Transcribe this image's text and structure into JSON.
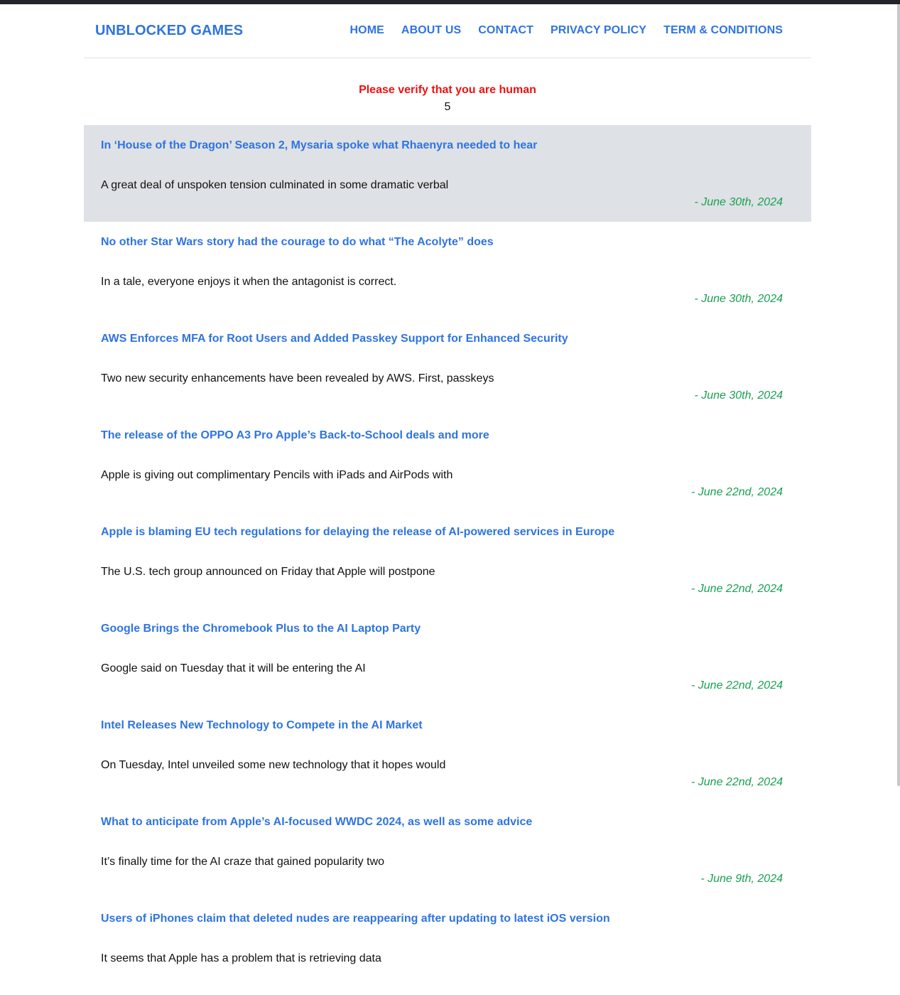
{
  "brand": "UNBLOCKED GAMES",
  "nav": [
    {
      "label": "HOME"
    },
    {
      "label": "ABOUT US"
    },
    {
      "label": "CONTACT"
    },
    {
      "label": "PRIVACY POLICY"
    },
    {
      "label": "TERM & CONDITIONS"
    }
  ],
  "verify": {
    "title": "Please verify that you are human",
    "countdown": "5"
  },
  "posts": [
    {
      "title": "In ‘House of the Dragon’ Season 2, Mysaria spoke what Rhaenyra needed to hear",
      "excerpt": "A great deal of unspoken tension culminated in some dramatic verbal",
      "date": "- June 30th, 2024"
    },
    {
      "title": "No other Star Wars story had the courage to do what “The Acolyte” does",
      "excerpt": "In a tale, everyone enjoys it when the antagonist is correct.",
      "date": "- June 30th, 2024"
    },
    {
      "title": "AWS Enforces MFA for Root Users and Added Passkey Support for Enhanced Security",
      "excerpt": "Two new security enhancements have been revealed by AWS. First, passkeys",
      "date": "- June 30th, 2024"
    },
    {
      "title": "The release of the OPPO A3 Pro Apple’s Back-to-School deals and more",
      "excerpt": "Apple is giving out complimentary Pencils with iPads and AirPods with",
      "date": "- June 22nd, 2024"
    },
    {
      "title": "Apple is blaming EU tech regulations for delaying the release of AI-powered services in Europe",
      "excerpt": "The U.S. tech group announced on Friday that Apple will postpone",
      "date": "- June 22nd, 2024"
    },
    {
      "title": "Google Brings the Chromebook Plus to the AI Laptop Party",
      "excerpt": "Google said on Tuesday that it will be entering the AI",
      "date": "- June 22nd, 2024"
    },
    {
      "title": "Intel Releases New Technology to Compete in the AI Market",
      "excerpt": "On Tuesday, Intel unveiled some new technology that it hopes would",
      "date": "- June 22nd, 2024"
    },
    {
      "title": "What to anticipate from Apple’s AI-focused WWDC 2024, as well as some advice",
      "excerpt": "It’s finally time for the AI craze that gained popularity two",
      "date": "- June 9th, 2024"
    },
    {
      "title": "Users of iPhones claim that deleted nudes are reappearing after updating to latest iOS version",
      "excerpt": "It seems that Apple has a problem that is retrieving data",
      "date": ""
    }
  ]
}
